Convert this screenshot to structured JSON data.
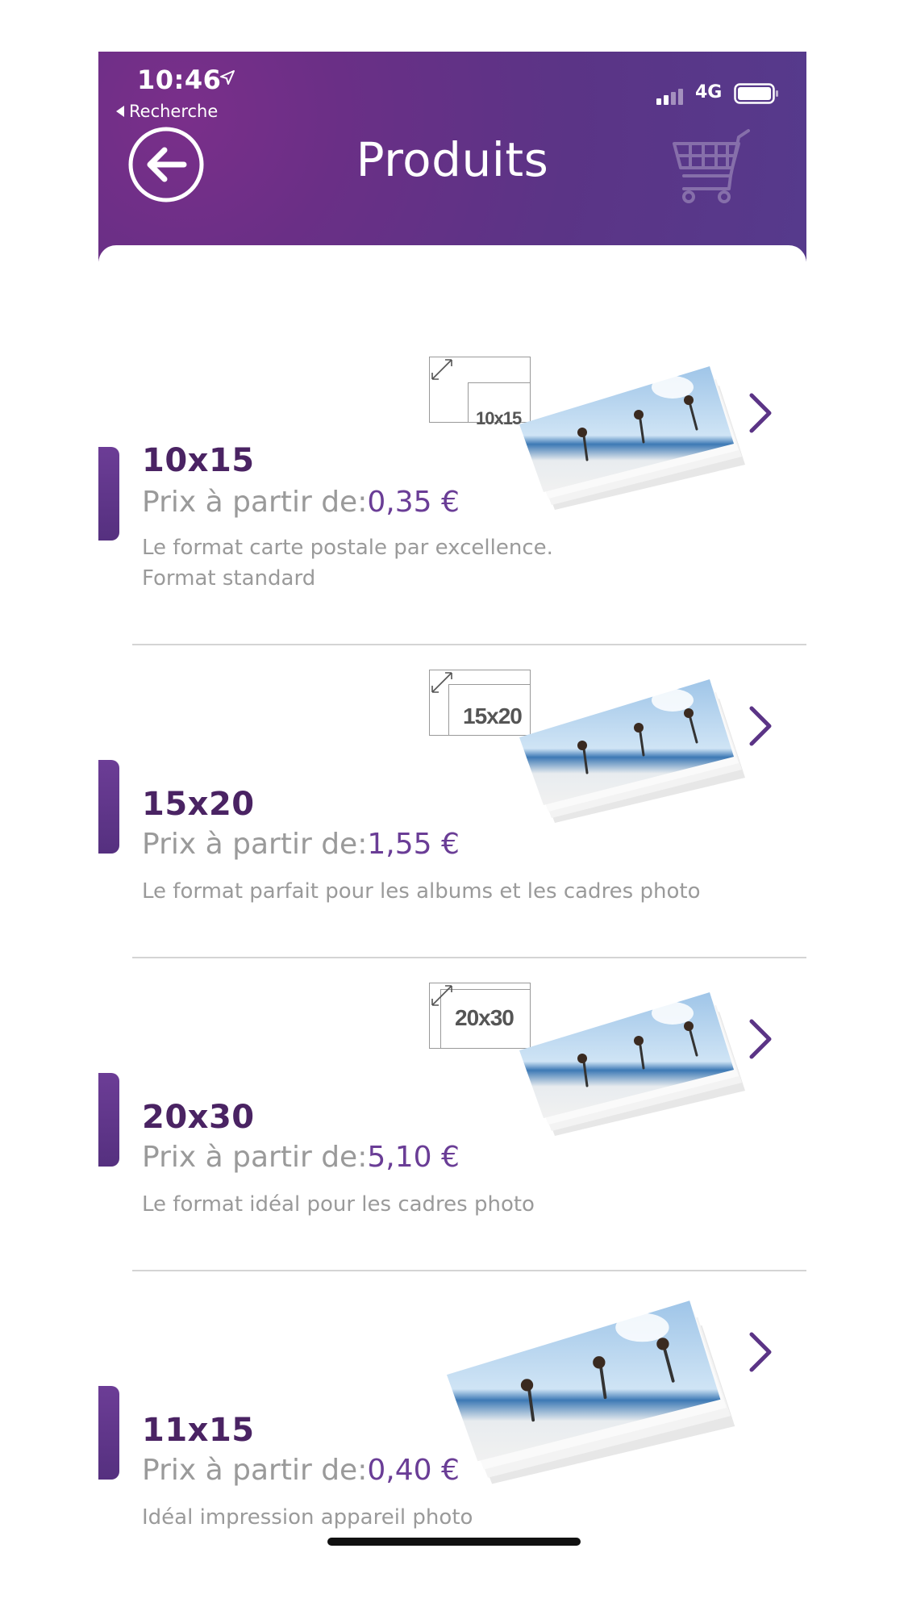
{
  "status_bar": {
    "time": "10:46",
    "back_app_label": "Recherche",
    "network": "4G"
  },
  "header": {
    "title": "Produits",
    "icons": [
      "back-arrow-icon",
      "cart-icon"
    ]
  },
  "products": [
    {
      "name": "10x15",
      "price_label": "Prix à partir de:",
      "price": "0,35 €",
      "description": [
        "Le format carte postale par excellence.",
        "Format standard"
      ],
      "size_badge": "10x15"
    },
    {
      "name": "15x20",
      "price_label": "Prix à partir de:",
      "price": "1,55 €",
      "description": [
        "Le format parfait pour les albums et les cadres photo"
      ],
      "size_badge": "15x20"
    },
    {
      "name": "20x30",
      "price_label": "Prix à partir de:",
      "price": "5,10 €",
      "description": [
        "Le format idéal pour les cadres photo"
      ],
      "size_badge": "20x30"
    },
    {
      "name": "11x15",
      "price_label": "Prix à partir de:",
      "price": "0,40 €",
      "description": [
        "Idéal impression appareil photo"
      ],
      "size_badge": ""
    }
  ],
  "colors": {
    "brand_purple": "#5b3486",
    "accent_purple": "#6a3d96",
    "name_purple": "#4a2363"
  }
}
